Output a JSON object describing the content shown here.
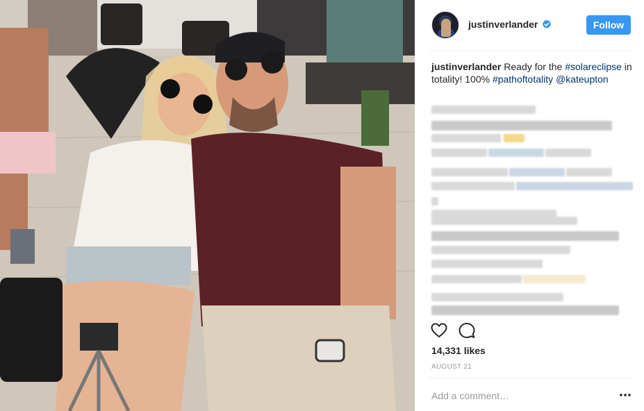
{
  "post": {
    "username": "justinverlander",
    "follow_label": "Follow",
    "caption": {
      "author": "justinverlander",
      "text_1": " Ready for the ",
      "tag_1": "#solareclipse",
      "text_2": " in totality! 100% ",
      "tag_2": "#pathoftotality",
      "text_3": " ",
      "mention": "@kateupton"
    },
    "likes": "14,331 likes",
    "date": "AUGUST 21",
    "comment_placeholder": "Add a comment…"
  },
  "icons": {
    "verified": "verified-badge-icon",
    "like": "heart-outline-icon",
    "comment": "speech-bubble-icon",
    "more": "ellipsis-icon"
  },
  "colors": {
    "follow_button": "#3897f0",
    "link": "#003569",
    "verified": "#3897f0",
    "muted_text": "#999999",
    "text": "#262626"
  }
}
